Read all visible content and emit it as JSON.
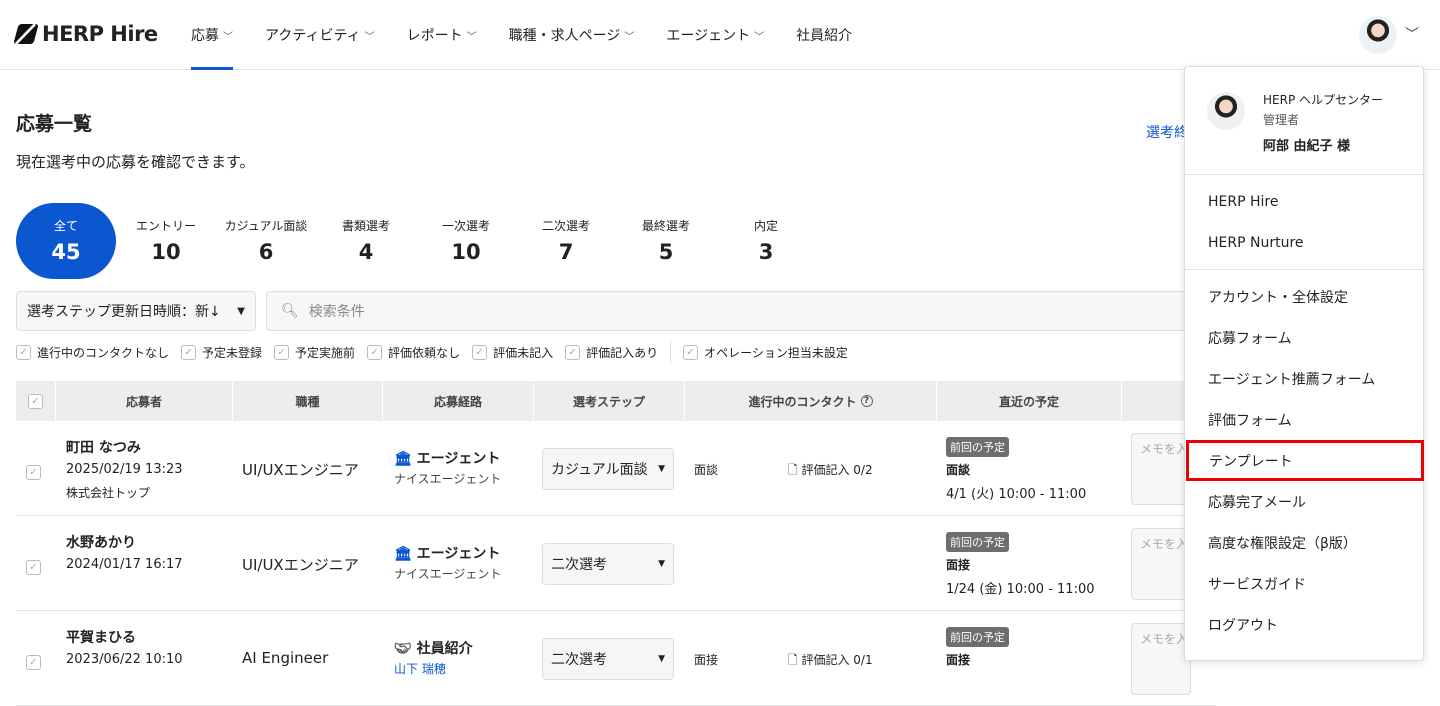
{
  "header": {
    "logo": "HERP Hire",
    "nav": [
      {
        "label": "応募",
        "chevron": true
      },
      {
        "label": "アクティビティ",
        "chevron": true
      },
      {
        "label": "レポート",
        "chevron": true
      },
      {
        "label": "職種・求人ページ",
        "chevron": true
      },
      {
        "label": "エージェント",
        "chevron": true
      },
      {
        "label": "社員紹介",
        "chevron": false
      }
    ]
  },
  "page": {
    "title": "応募一覧",
    "subtitle": "現在選考中の応募を確認できます。",
    "link": "選考終"
  },
  "stats": [
    {
      "label": "全て",
      "count": "45"
    },
    {
      "label": "エントリー",
      "count": "10"
    },
    {
      "label": "カジュアル面談",
      "count": "6"
    },
    {
      "label": "書類選考",
      "count": "4"
    },
    {
      "label": "一次選考",
      "count": "10"
    },
    {
      "label": "二次選考",
      "count": "7"
    },
    {
      "label": "最終選考",
      "count": "5"
    },
    {
      "label": "内定",
      "count": "3"
    }
  ],
  "sort": {
    "value": "選考ステップ更新日時順：新↓"
  },
  "search": {
    "placeholder": "検索条件"
  },
  "filters": [
    "進行中のコンタクトなし",
    "予定未登録",
    "予定実施前",
    "評価依頼なし",
    "評価未記入",
    "評価記入あり",
    "オペレーション担当未設定"
  ],
  "table": {
    "columns": [
      "応募者",
      "職種",
      "応募経路",
      "選考ステップ",
      "進行中のコンタクト",
      "直近の予定"
    ],
    "rows": [
      {
        "name": "町田 なつみ",
        "date": "2025/02/19 13:23",
        "company": "株式会社トップ",
        "job": "UI/UXエンジニア",
        "route": "エージェント",
        "route_sub": "ナイスエージェント",
        "step": "カジュアル面談",
        "contact": "面談",
        "eval": "評価記入 0/2",
        "badge": "前回の予定",
        "event": "面談",
        "event_time": "4/1 (火) 10:00 - 11:00",
        "memo": "メモを入力"
      },
      {
        "name": "水野あかり",
        "date": "2024/01/17 16:17",
        "company": "",
        "job": "UI/UXエンジニア",
        "route": "エージェント",
        "route_sub": "ナイスエージェント",
        "step": "二次選考",
        "contact": "",
        "eval": "",
        "badge": "前回の予定",
        "event": "面接",
        "event_time": "1/24 (金) 10:00 - 11:00",
        "memo": "メモを入力"
      },
      {
        "name": "平賀まひる",
        "date": "2023/06/22 10:10",
        "company": "",
        "job": "AI Engineer",
        "route": "社員紹介",
        "route_sub": "山下 瑞穂",
        "step": "二次選考",
        "contact": "面接",
        "eval": "評価記入 0/1",
        "badge": "前回の予定",
        "event": "面接",
        "event_time": "",
        "memo": "メモを入力"
      }
    ]
  },
  "menu": {
    "org": "HERP ヘルプセンター",
    "role": "管理者",
    "user": "阿部 由紀子 様",
    "products": [
      "HERP Hire",
      "HERP Nurture"
    ],
    "items": [
      "アカウント・全体設定",
      "応募フォーム",
      "エージェント推薦フォーム",
      "評価フォーム",
      "テンプレート",
      "応募完了メール",
      "高度な権限設定（β版）",
      "サービスガイド",
      "ログアウト"
    ],
    "highlighted": "テンプレート"
  }
}
